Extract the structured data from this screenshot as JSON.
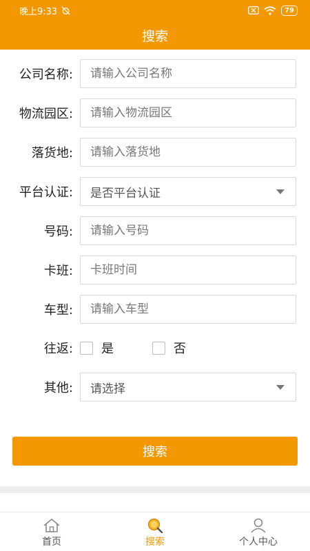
{
  "status_bar": {
    "time": "晚上9:33",
    "battery": "79"
  },
  "header": {
    "title": "搜索"
  },
  "form": {
    "company": {
      "label": "公司名称:",
      "placeholder": "请输入公司名称"
    },
    "park": {
      "label": "物流园区:",
      "placeholder": "请输入物流园区"
    },
    "destination": {
      "label": "落货地:",
      "placeholder": "请输入落货地"
    },
    "platform_cert": {
      "label": "平台认证:",
      "value": "是否平台认证"
    },
    "number": {
      "label": "号码:",
      "placeholder": "请输入号码"
    },
    "schedule": {
      "label": "卡班:",
      "placeholder": "卡班时间"
    },
    "vehicle": {
      "label": "车型:",
      "placeholder": "请输入车型"
    },
    "round_trip": {
      "label": "往返:",
      "options": [
        "是",
        "否"
      ]
    },
    "other": {
      "label": "其他:",
      "value": "请选择"
    }
  },
  "search_button": {
    "label": "搜索"
  },
  "tab_bar": {
    "items": [
      {
        "label": "首页",
        "icon": "home-icon"
      },
      {
        "label": "搜索",
        "icon": "search-icon"
      },
      {
        "label": "个人中心",
        "icon": "user-icon"
      }
    ],
    "active_color": "#f39800"
  },
  "colors": {
    "brand": "#f39800"
  }
}
